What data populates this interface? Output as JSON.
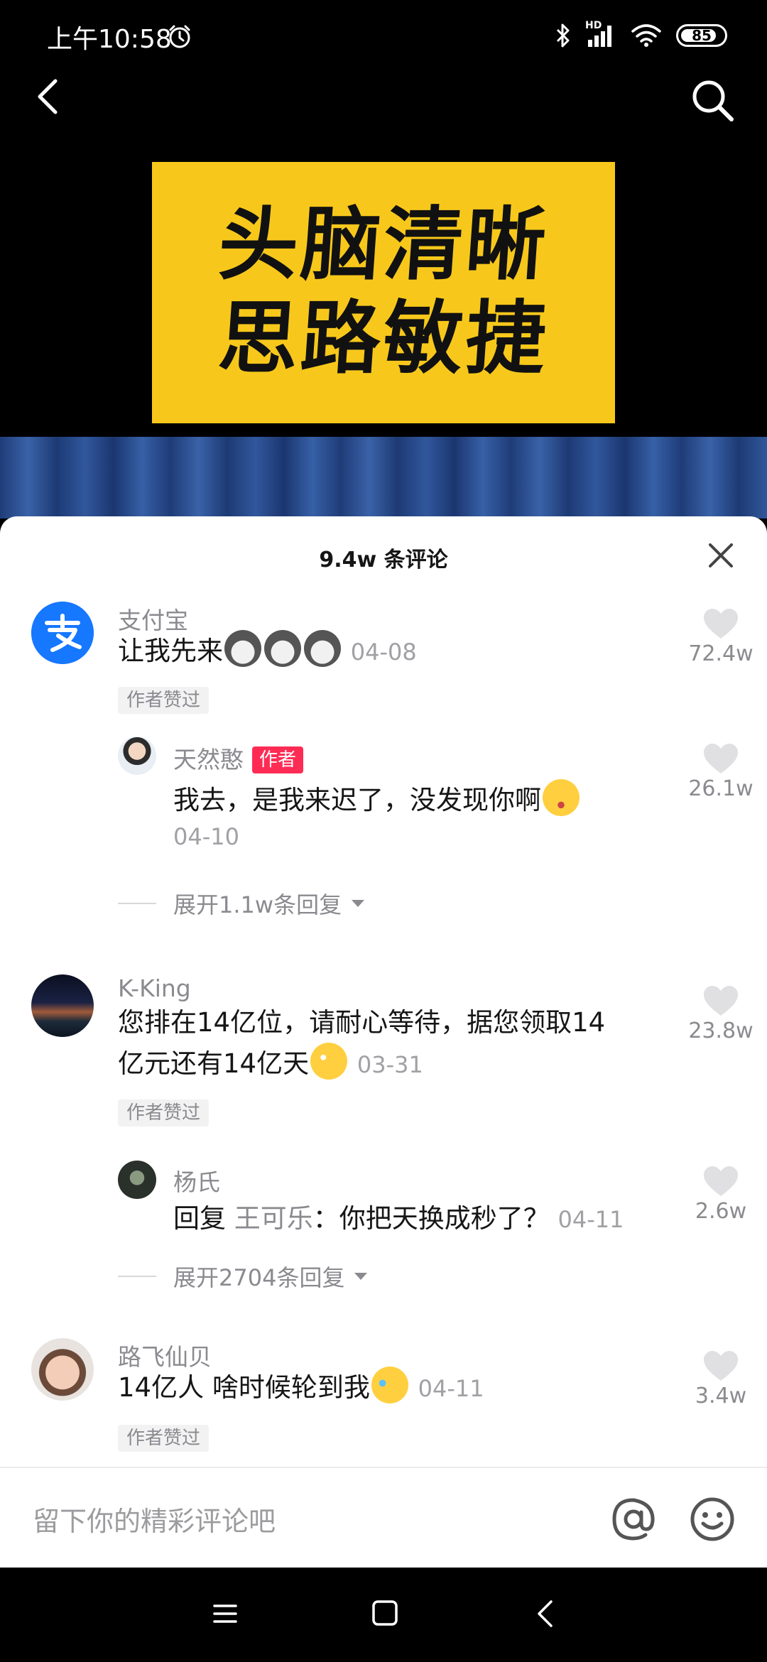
{
  "status_bar": {
    "time": "上午10:58",
    "network_label": "HD",
    "battery_level": 85,
    "battery_text": "85",
    "icons": [
      "alarm-icon",
      "bluetooth-icon",
      "signal-icon",
      "wifi-icon",
      "battery-icon"
    ]
  },
  "top_bar": {
    "icons": [
      "back-icon",
      "search-icon"
    ]
  },
  "video": {
    "banner_line1": "头脑清晰",
    "banner_line2": "思路敏捷",
    "banner_color": "#f7c81b"
  },
  "comments_sheet": {
    "title": "9.4w 条评论",
    "comments": [
      {
        "username": "支付宝",
        "text": "让我先来",
        "emoji": [
          "husky-emoji",
          "husky-emoji",
          "husky-emoji"
        ],
        "time": "04-08",
        "author_liked_label": "作者赞过",
        "likes": "72.4w",
        "reply": {
          "username": "天然憨",
          "author_badge": "作者",
          "text": "我去，是我来迟了，没发现你啊",
          "emoji": "shocked-emoji",
          "time": "04-10",
          "likes": "26.1w"
        },
        "expand_label": "展开1.1w条回复"
      },
      {
        "username": "K-King",
        "text_line1": "您排在14亿位，请耐心等待，据您领取14",
        "text_line2": "亿元还有14亿天",
        "emoji": "dizzy-emoji",
        "time": "03-31",
        "author_liked_label": "作者赞过",
        "likes": "23.8w",
        "reply": {
          "username": "杨氏",
          "reply_prefix": "回复",
          "reply_to": "王可乐",
          "text": "：你把天换成秒了？",
          "time": "04-11",
          "likes": "2.6w"
        },
        "expand_label": "展开2704条回复"
      },
      {
        "username": "路飞仙贝",
        "text": "14亿人 啥时候轮到我",
        "emoji": "laugh-cry-emoji",
        "time": "04-11",
        "author_liked_label": "作者赞过",
        "likes": "3.4w"
      }
    ]
  },
  "input_bar": {
    "placeholder": "留下你的精彩评论吧",
    "icons": [
      "at-icon",
      "emoji-icon"
    ]
  },
  "nav_bar": {
    "icons": [
      "menu-icon",
      "home-icon",
      "back-icon"
    ]
  },
  "colors": {
    "author_badge": "#fe2c55",
    "alipay_blue": "#1677ff",
    "secondary_text": "#8a8a8f"
  }
}
